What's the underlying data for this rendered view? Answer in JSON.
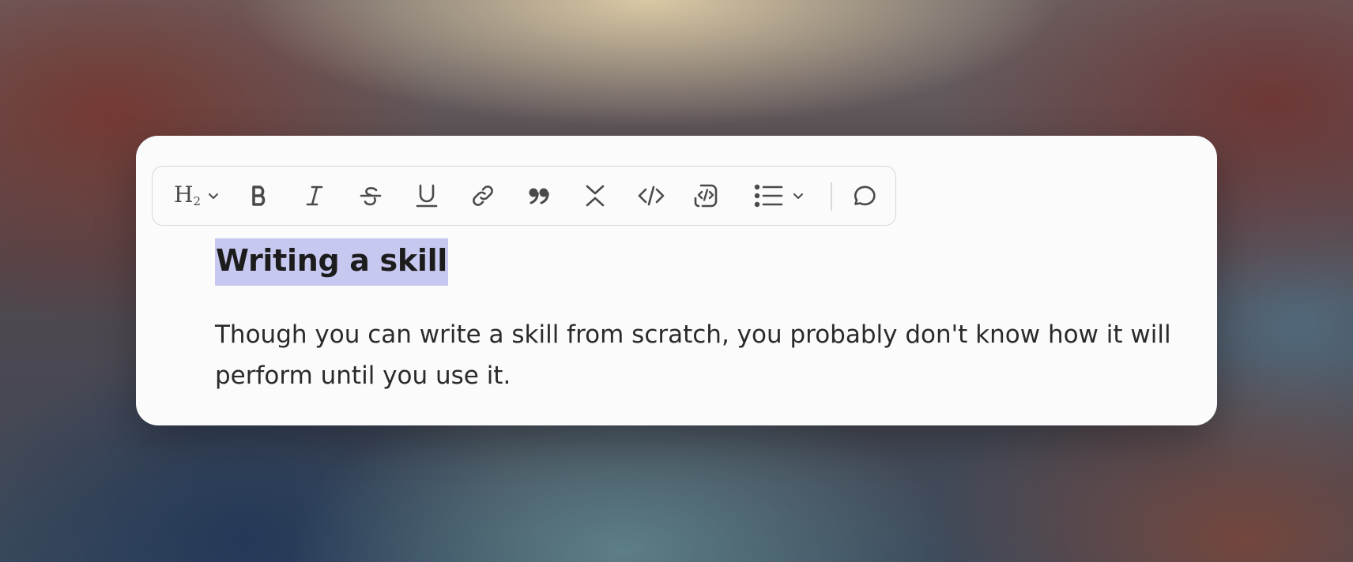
{
  "toolbar": {
    "heading_label": "H2",
    "icons": {
      "heading": "heading-2-icon",
      "bold": "bold-icon",
      "italic": "italic-icon",
      "strikethrough": "strikethrough-icon",
      "underline": "underline-icon",
      "link": "link-icon",
      "quote": "quote-icon",
      "collapse": "collapse-icon",
      "code": "code-icon",
      "code_block": "code-block-icon",
      "list": "bullet-list-icon",
      "comment": "comment-icon"
    }
  },
  "editor": {
    "heading": "Writing a skill",
    "paragraph": "Though you can write a skill from scratch, you probably don't know how it will perform until you use it."
  },
  "colors": {
    "selection_highlight": "#c7c8f0",
    "card_background": "#fbfbfb",
    "icon_color": "#4a4a4a"
  }
}
